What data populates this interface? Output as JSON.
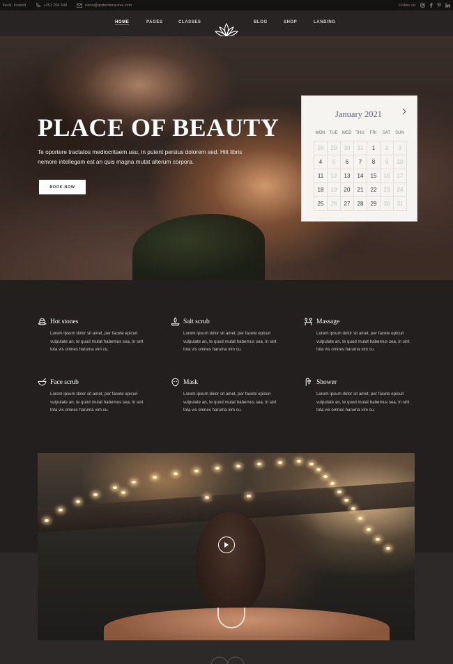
{
  "topbar": {
    "location": "ſlavík, Iceland",
    "phone": "+351 256 548",
    "email": "reina@qodeinteractive.com",
    "follow_label": "Follow us:",
    "social_icons": [
      "instagram-icon",
      "facebook-icon",
      "pinterest-icon",
      "linkedin-icon"
    ]
  },
  "nav": {
    "items": [
      {
        "label": "HOME",
        "active": true
      },
      {
        "label": "PAGES"
      },
      {
        "label": "CLASSES"
      },
      {
        "label": "BLOG"
      },
      {
        "label": "SHOP"
      },
      {
        "label": "LANDING"
      }
    ],
    "logo_icon": "lotus-icon"
  },
  "hero": {
    "title": "PLACE OF BEAUTY",
    "text": "Te oportere tractatos mediocritaem usu, in putent persius dolorem sed. Hilt libris nemore intellegam est an quis magna mutat alterum corpora.",
    "button": "BOOK NOW"
  },
  "calendar": {
    "month": "January 2021",
    "next_icon": "chevron-right-icon",
    "days": [
      "MON",
      "TUE",
      "WED",
      "THU",
      "FRI",
      "SAT",
      "SUN"
    ],
    "weeks": [
      [
        {
          "d": "28",
          "m": true
        },
        {
          "d": "29",
          "m": true
        },
        {
          "d": "30",
          "m": true
        },
        {
          "d": "31",
          "m": true
        },
        {
          "d": "1"
        },
        {
          "d": "2",
          "m": true
        },
        {
          "d": "3",
          "m": true
        }
      ],
      [
        {
          "d": "4"
        },
        {
          "d": "5",
          "m": true
        },
        {
          "d": "6"
        },
        {
          "d": "7"
        },
        {
          "d": "8"
        },
        {
          "d": "9",
          "m": true
        },
        {
          "d": "10",
          "m": true
        }
      ],
      [
        {
          "d": "11"
        },
        {
          "d": "12",
          "m": true
        },
        {
          "d": "13"
        },
        {
          "d": "14"
        },
        {
          "d": "15"
        },
        {
          "d": "16",
          "m": true
        },
        {
          "d": "17",
          "m": true
        }
      ],
      [
        {
          "d": "18"
        },
        {
          "d": "19",
          "m": true
        },
        {
          "d": "20"
        },
        {
          "d": "21"
        },
        {
          "d": "22"
        },
        {
          "d": "23",
          "m": true
        },
        {
          "d": "24",
          "m": true
        }
      ],
      [
        {
          "d": "25"
        },
        {
          "d": "26",
          "m": true
        },
        {
          "d": "27"
        },
        {
          "d": "28"
        },
        {
          "d": "29"
        },
        {
          "d": "30",
          "m": true
        },
        {
          "d": "31",
          "m": true
        }
      ]
    ]
  },
  "features": [
    {
      "title": "Hot stones",
      "icon": "hot-stones-icon",
      "text": "Lorem ipsum dolor sit amet, per facete epicuri vulputate an, te quod mutat habemus sea, in sint tota vis omnes haruma vim cu."
    },
    {
      "title": "Salt scrub",
      "icon": "salt-scrub-icon",
      "text": "Lorem ipsum dolor sit amet, per facete epicuri vulputate an, te quod mutat habemus sea, in sint tota vis omnes haruma vim cu."
    },
    {
      "title": "Massage",
      "icon": "massage-icon",
      "text": "Lorem ipsum dolor sit amet, per facete epicuri vulputate an, te quod mutat habemus sea, in sint tota vis omnes haruma vim cu."
    },
    {
      "title": "Face scrub",
      "icon": "face-scrub-icon",
      "text": "Lorem ipsum dolor sit amet, per facete epicuri vulputate an, te quod mutat habemus sea, in sint tota vis omnes haruma vim cu."
    },
    {
      "title": "Mask",
      "icon": "mask-icon",
      "text": "Lorem ipsum dolor sit amet, per facete epicuri vulputate an, te quod mutat habemus sea, in sint tota vis omnes haruma vim cu."
    },
    {
      "title": "Shower",
      "icon": "shower-icon",
      "text": "Lorem ipsum dolor sit amet, per facete epicuri vulputate an, te quod mutat habemus sea, in sint tota vis omnes haruma vim cu."
    }
  ],
  "video": {
    "play_icon": "play-icon"
  },
  "colors": {
    "dark_bg": "#221f1e",
    "topbar_bg": "#151312",
    "nav_bg": "#272423",
    "calendar_bg": "#f6f4f1",
    "accent_text": "#5d6075"
  }
}
